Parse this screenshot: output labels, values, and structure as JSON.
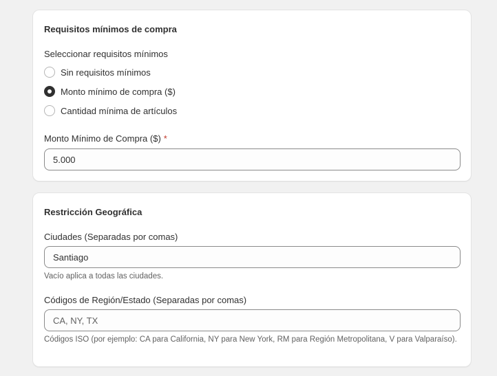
{
  "min_purchase": {
    "title": "Requisitos mínimos de compra",
    "select_label": "Seleccionar requisitos mínimos",
    "options": [
      {
        "label": "Sin requisitos mínimos",
        "checked": false
      },
      {
        "label": "Monto mínimo de compra ($)",
        "checked": true
      },
      {
        "label": "Cantidad mínima de artículos",
        "checked": false
      }
    ],
    "amount_label": "Monto Mínimo de Compra ($)",
    "required_mark": "*",
    "amount_value": "5.000"
  },
  "geo": {
    "title": "Restricción Geográfica",
    "cities_label": "Ciudades (Separadas por comas)",
    "cities_value": "Santiago",
    "cities_help": "Vacío aplica a todas las ciudades.",
    "regions_label": "Códigos de Región/Estado (Separadas por comas)",
    "regions_value": "",
    "regions_placeholder": "CA, NY, TX",
    "regions_help": "Códigos ISO (por ejemplo: CA para California, NY para New York, RM para Región Metropolitana, V para Valparaíso)."
  },
  "colors": {
    "page_bg": "#f1f1f1",
    "card_bg": "#ffffff",
    "text": "#303030",
    "required": "#c0392b"
  }
}
